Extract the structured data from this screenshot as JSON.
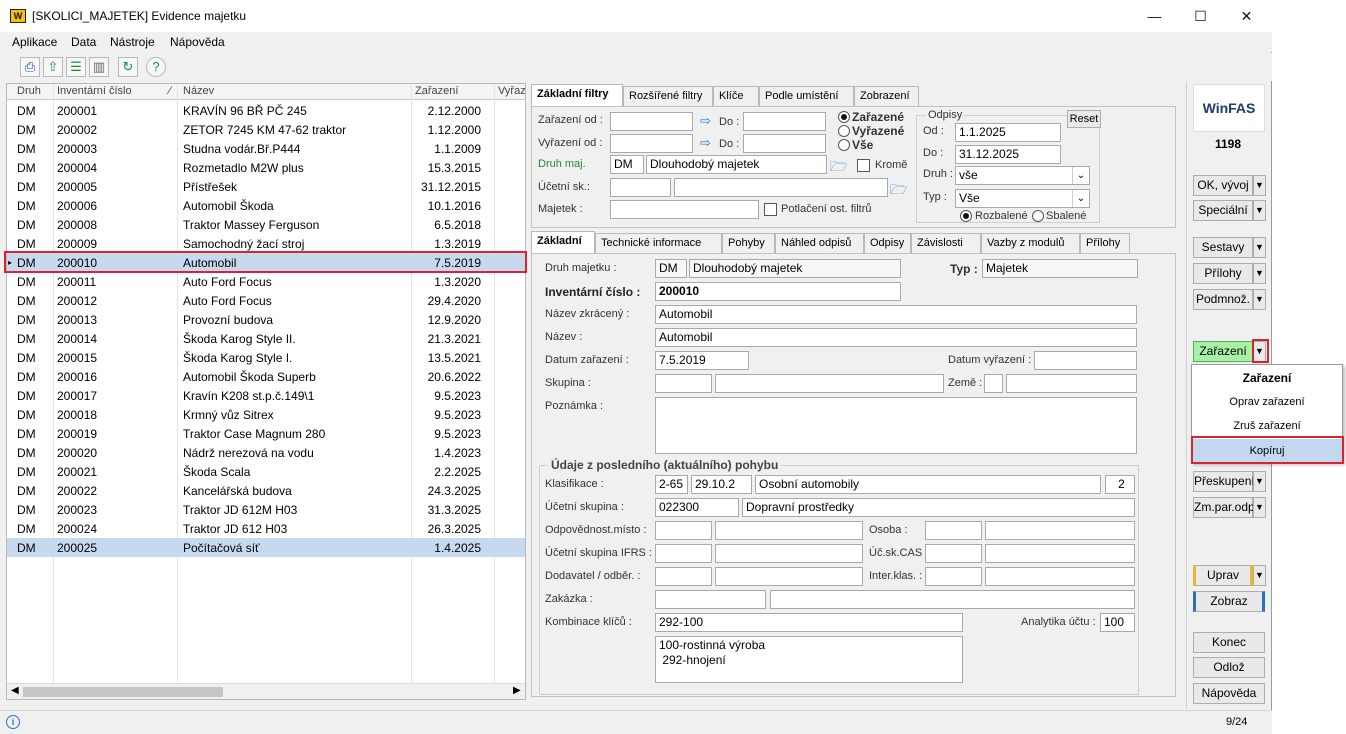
{
  "window": {
    "title": "[SKOLICI_MAJETEK] Evidence majetku",
    "logo": "W",
    "minimize": "—",
    "maximize": "☐",
    "close": "✕"
  },
  "menu": [
    "Aplikace",
    "Data",
    "Nástroje",
    "Nápověda"
  ],
  "toolbar_icons": [
    "printer-icon",
    "export-icon",
    "list-icon",
    "columns-icon",
    "refresh-icon",
    "help-icon"
  ],
  "grid": {
    "headers": {
      "druh": "Druh",
      "inv": "Inventární číslo",
      "nazev": "Název",
      "zar": "Zařazení",
      "vyr": "Vyřaz"
    },
    "rows": [
      {
        "druh": "DM",
        "inv": "200001",
        "nazev": "KRAVÍN 96 BŘ PČ 245",
        "zar": "2.12.2000"
      },
      {
        "druh": "DM",
        "inv": "200002",
        "nazev": "ZETOR 7245 KM 47-62 traktor",
        "zar": "1.12.2000"
      },
      {
        "druh": "DM",
        "inv": "200003",
        "nazev": "Studna vodár.Bř.P444",
        "zar": "1.1.2009"
      },
      {
        "druh": "DM",
        "inv": "200004",
        "nazev": "Rozmetadlo M2W plus",
        "zar": "15.3.2015"
      },
      {
        "druh": "DM",
        "inv": "200005",
        "nazev": "Přístřešek",
        "zar": "31.12.2015"
      },
      {
        "druh": "DM",
        "inv": "200006",
        "nazev": "Automobil Škoda",
        "zar": "10.1.2016"
      },
      {
        "druh": "DM",
        "inv": "200008",
        "nazev": "Traktor Massey Ferguson",
        "zar": "6.5.2018"
      },
      {
        "druh": "DM",
        "inv": "200009",
        "nazev": "Samochodný žací stroj",
        "zar": "1.3.2019"
      },
      {
        "druh": "DM",
        "inv": "200010",
        "nazev": "Automobil",
        "zar": "7.5.2019"
      },
      {
        "druh": "DM",
        "inv": "200011",
        "nazev": "Auto Ford Focus",
        "zar": "1.3.2020"
      },
      {
        "druh": "DM",
        "inv": "200012",
        "nazev": "Auto Ford Focus",
        "zar": "29.4.2020"
      },
      {
        "druh": "DM",
        "inv": "200013",
        "nazev": "Provozní budova",
        "zar": "12.9.2020"
      },
      {
        "druh": "DM",
        "inv": "200014",
        "nazev": "Škoda Karog Style II.",
        "zar": "21.3.2021"
      },
      {
        "druh": "DM",
        "inv": "200015",
        "nazev": "Škoda Karog Style I.",
        "zar": "13.5.2021"
      },
      {
        "druh": "DM",
        "inv": "200016",
        "nazev": "Automobil Škoda Superb",
        "zar": "20.6.2022"
      },
      {
        "druh": "DM",
        "inv": "200017",
        "nazev": "Kravín K208 st.p.č.149\\1",
        "zar": "9.5.2023"
      },
      {
        "druh": "DM",
        "inv": "200018",
        "nazev": "Krmný vůz Sitrex",
        "zar": "9.5.2023"
      },
      {
        "druh": "DM",
        "inv": "200019",
        "nazev": "Traktor Case Magnum 280",
        "zar": "9.5.2023"
      },
      {
        "druh": "DM",
        "inv": "200020",
        "nazev": "Nádrž nerezová na vodu",
        "zar": "1.4.2023"
      },
      {
        "druh": "DM",
        "inv": "200021",
        "nazev": "Škoda Scala",
        "zar": "2.2.2025"
      },
      {
        "druh": "DM",
        "inv": "200022",
        "nazev": "Kancelářská budova",
        "zar": "24.3.2025"
      },
      {
        "druh": "DM",
        "inv": "200023",
        "nazev": "Traktor JD 612M H03",
        "zar": "31.3.2025"
      },
      {
        "druh": "DM",
        "inv": "200024",
        "nazev": "Traktor JD 612 H03",
        "zar": "26.3.2025"
      },
      {
        "druh": "DM",
        "inv": "200025",
        "nazev": "Počítačová síť",
        "zar": "1.4.2025"
      }
    ]
  },
  "filter_tabs": [
    "Základní filtry",
    "Rozšířené filtry",
    "Klíče",
    "Podle umístění",
    "Zobrazení"
  ],
  "filters": {
    "zar_od": "Zařazení od :",
    "vyr_od": "Vyřazení od :",
    "do": "Do :",
    "druh_maj": "Druh maj.",
    "druh_code": "DM",
    "druh_name": "Dlouhodobý majetek",
    "krome": "Kromě",
    "ucetni_sk": "Účetní sk.:",
    "majetek": "Majetek :",
    "potlaceni": "Potlačení ost. filtrů",
    "radio_zarazene": "Zařazené",
    "radio_vyrazene": "Vyřazené",
    "radio_vse": "Vše",
    "odpisy_title": "Odpisy",
    "reset": "Reset",
    "od_label": "Od :",
    "od_value": "1.1.2025",
    "do_label": "Do :",
    "do_value": "31.12.2025",
    "druh_label": "Druh :",
    "druh_value": "vše",
    "typ_label": "Typ :",
    "typ_value": "Vše",
    "rozbalene": "Rozbalené",
    "sbalene": "Sbalené"
  },
  "detail_tabs": [
    "Základní",
    "Technické informace",
    "Pohyby",
    "Náhled odpisů",
    "Odpisy",
    "Závislosti",
    "Vazby z modulů",
    "Přílohy"
  ],
  "detail": {
    "druh_label": "Druh majetku :",
    "druh_code": "DM",
    "druh_name": "Dlouhodobý majetek",
    "typ_label": "Typ :",
    "typ_value": "Majetek",
    "inv_label": "Inventární číslo :",
    "inv_value": "200010",
    "nazev_zkr_label": "Název zkrácený :",
    "nazev_zkr_value": "Automobil",
    "nazev_label": "Název :",
    "nazev_value": "Automobil",
    "datum_zar_label": "Datum zařazení :",
    "datum_zar_value": "7.5.2019",
    "datum_vyr_label": "Datum vyřazení :",
    "skupina_label": "Skupina :",
    "zeme_label": "Země :",
    "poznamka_label": "Poznámka :",
    "pohyb_title": "Údaje z posledního (aktuálního) pohybu",
    "klas_label": "Klasifikace :",
    "klas_code": "2-65",
    "klas_sub": "29.10.2",
    "klas_name": "Osobní automobily",
    "klas_num": "2",
    "ucet_sk_label": "Účetní skupina :",
    "ucet_sk_code": "022300",
    "ucet_sk_name": "Dopravní prostředky",
    "odp_misto_label": "Odpovědnost.místo :",
    "osoba_label": "Osoba :",
    "ifrs_label": "Účetní skupina IFRS :",
    "cas_label": "Úč.sk.CAS :",
    "dodavatel_label": "Dodavatel / odběr. :",
    "inter_label": "Inter.klas. :",
    "zakazka_label": "Zakázka :",
    "kombinace_label": "Kombinace klíčů :",
    "kombinace_value": "292-100",
    "analytika_label": "Analytika účtu :",
    "analytika_value": "100",
    "keys_line1": "100-rostinná výroba",
    "keys_line2": " 292-hnojení"
  },
  "right": {
    "brand": "WinFAS",
    "count": "1198",
    "ok": "OK, vývoj",
    "specialni": "Speciální",
    "sestavy": "Sestavy",
    "prilohy": "Přílohy",
    "podmnoz": "Podmnož.",
    "zarazeni": "Zařazení",
    "preskupeni": "Přeskupení",
    "zmparodp": "Zm.par.odp",
    "uprav": "Uprav",
    "zobraz": "Zobraz",
    "konec": "Konec",
    "odloz": "Odlož",
    "napoveda": "Nápověda"
  },
  "popup": [
    "Zařazení",
    "Oprav zařazení",
    "Zruš zařazení",
    "Kopíruj"
  ],
  "status": {
    "info": "i",
    "page": "9/24"
  },
  "colors": {
    "selected_row": "#c6d9ef",
    "highlight": "#d9232e",
    "zarazeni_btn": "#a8f0a8",
    "popup_selected": "#c3d7ee"
  }
}
